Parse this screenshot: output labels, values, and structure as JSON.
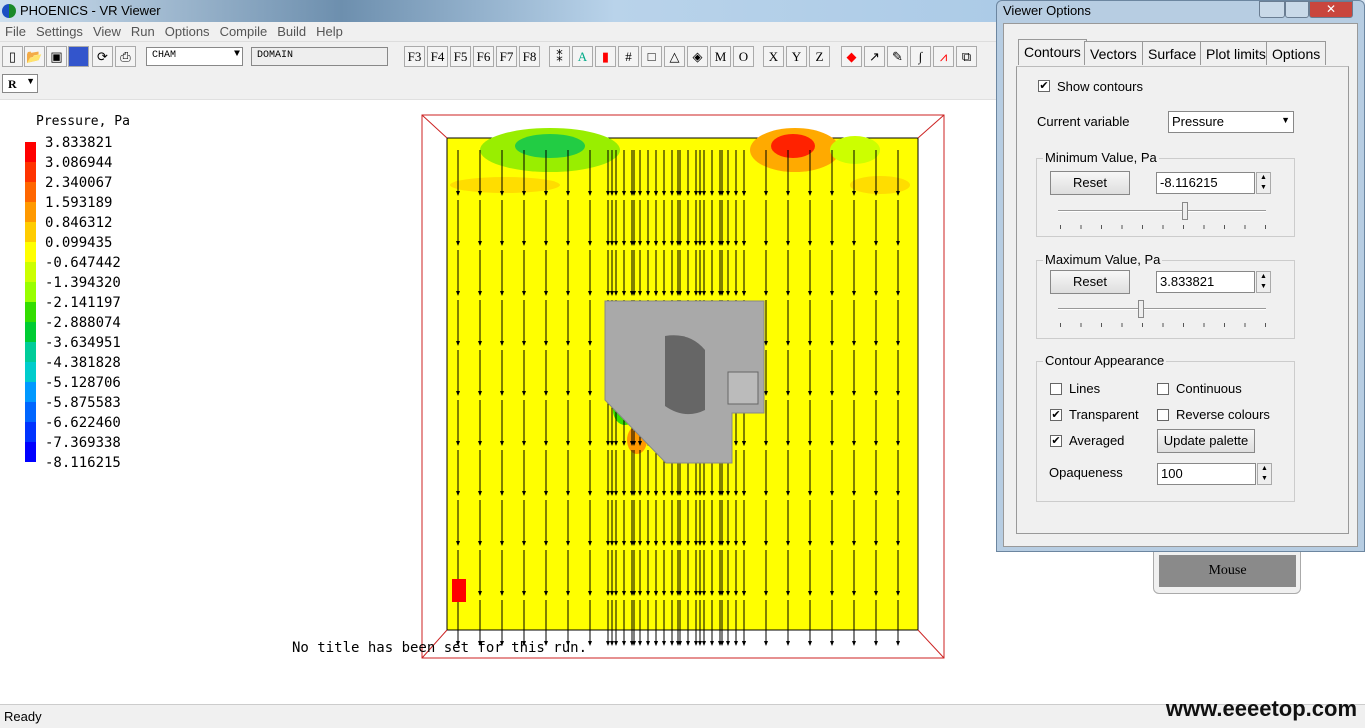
{
  "window": {
    "title": "PHOENICS - VR Viewer"
  },
  "menu": [
    "File",
    "Settings",
    "View",
    "Run",
    "Options",
    "Compile",
    "Build",
    "Help"
  ],
  "toolbar": {
    "combo1": "CHAM",
    "combo2": "DOMAIN",
    "fkeys": [
      "F3",
      "F4",
      "F5",
      "F6",
      "F7",
      "F8"
    ],
    "letters": [
      "M",
      "O",
      "X",
      "Y",
      "Z"
    ],
    "r_combo": "R"
  },
  "legend": {
    "title": "Pressure, Pa",
    "values": [
      "3.833821",
      "3.086944",
      "2.340067",
      "1.593189",
      "0.846312",
      "0.099435",
      "-0.647442",
      "-1.394320",
      "-2.141197",
      "-2.888074",
      "-3.634951",
      "-4.381828",
      "-5.128706",
      "-5.875583",
      "-6.622460",
      "-7.369338",
      "-8.116215"
    ],
    "colors": [
      "#ff0000",
      "#ff3300",
      "#ff6600",
      "#ff9900",
      "#ffcc00",
      "#ffff00",
      "#ccff00",
      "#99ff00",
      "#33dd00",
      "#00cc33",
      "#00cc99",
      "#00cccc",
      "#0099ff",
      "#0066ff",
      "#0033ff",
      "#0000ff"
    ]
  },
  "run_title": "No title has been set for this run.",
  "status": "Ready",
  "watermark": "www.eeeetop.com",
  "mouse_button": "Mouse",
  "dialog": {
    "title": "Viewer Options",
    "tabs": [
      "Contours",
      "Vectors",
      "Surface",
      "Plot limits",
      "Options"
    ],
    "active_tab": "Contours",
    "show_contours": {
      "label": "Show contours",
      "checked": true
    },
    "current_variable": {
      "label": "Current variable",
      "value": "Pressure"
    },
    "min_group": {
      "label": "Minimum Value, Pa",
      "reset": "Reset",
      "value": "-8.116215",
      "slider_pct": 61
    },
    "max_group": {
      "label": "Maximum Value, Pa",
      "reset": "Reset",
      "value": "3.833821",
      "slider_pct": 40
    },
    "appearance": {
      "label": "Contour Appearance",
      "lines": "Lines",
      "continuous": "Continuous",
      "transparent": "Transparent",
      "reverse": "Reverse colours",
      "averaged": "Averaged",
      "update": "Update palette",
      "opaqueness_label": "Opaqueness",
      "opaqueness": "100"
    }
  }
}
